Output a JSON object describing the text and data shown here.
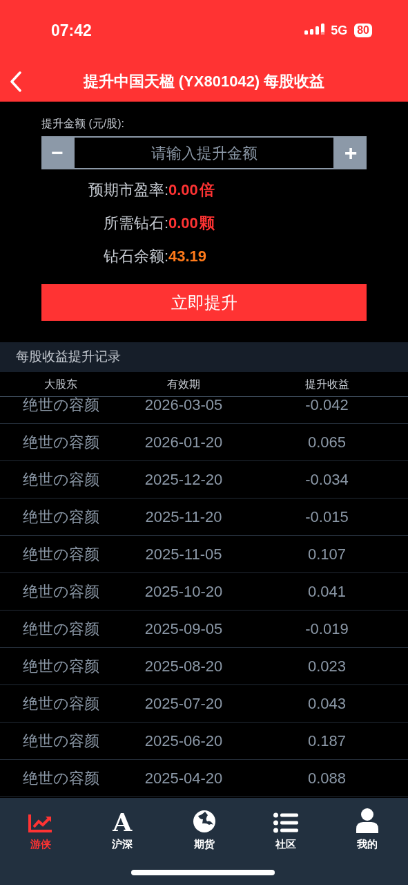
{
  "status_bar": {
    "time": "07:42",
    "network": "5G",
    "battery": "80"
  },
  "header": {
    "title": "提升中国天楹 (YX801042) 每股收益"
  },
  "form": {
    "label": "提升金额 (元/股):",
    "minus": "−",
    "plus": "+",
    "placeholder": "请输入提升金额",
    "info": [
      {
        "label": "预期市盈率:",
        "value": "0.00",
        "unit": "倍",
        "color": "#ff3333"
      },
      {
        "label": "所需钻石:",
        "value": "0.00",
        "unit": "颗",
        "color": "#ff3333"
      },
      {
        "label": "钻石余额:",
        "value": "43.19",
        "color": "#ff7a1a"
      }
    ],
    "submit": "立即提升"
  },
  "records": {
    "title": "每股收益提升记录",
    "columns": [
      "大股东",
      "有效期",
      "提升收益"
    ],
    "rows": [
      [
        "绝世の容颜",
        "2026-03-05",
        "-0.042"
      ],
      [
        "绝世の容颜",
        "2026-01-20",
        "0.065"
      ],
      [
        "绝世の容颜",
        "2025-12-20",
        "-0.034"
      ],
      [
        "绝世の容颜",
        "2025-11-20",
        "-0.015"
      ],
      [
        "绝世の容颜",
        "2025-11-05",
        "0.107"
      ],
      [
        "绝世の容颜",
        "2025-10-20",
        "0.041"
      ],
      [
        "绝世の容颜",
        "2025-09-05",
        "-0.019"
      ],
      [
        "绝世の容颜",
        "2025-08-20",
        "0.023"
      ],
      [
        "绝世の容颜",
        "2025-07-20",
        "0.043"
      ],
      [
        "绝世の容颜",
        "2025-06-20",
        "0.187"
      ],
      [
        "绝世の容颜",
        "2025-04-20",
        "0.088"
      ]
    ]
  },
  "tab_bar": [
    {
      "label": "游侠",
      "kind": "chart",
      "selected": true
    },
    {
      "label": "沪深",
      "kind": "letter",
      "glyph": "A",
      "selected": false
    },
    {
      "label": "期货",
      "kind": "globe",
      "selected": false
    },
    {
      "label": "社区",
      "kind": "list",
      "selected": false
    },
    {
      "label": "我的",
      "kind": "person",
      "selected": false
    }
  ]
}
